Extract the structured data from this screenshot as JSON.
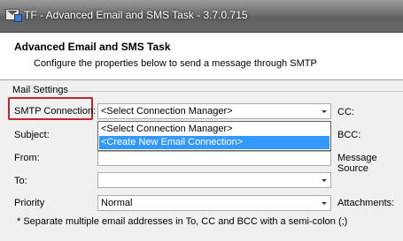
{
  "window": {
    "title": "TF - Advanced Email and SMS Task - 3.7.0.715",
    "icon": "email-task-icon"
  },
  "header": {
    "title": "Advanced Email and SMS Task",
    "subtitle": "Configure the properties below to send a message through SMTP"
  },
  "mail_settings": {
    "group_label": "Mail Settings",
    "smtp_connection": {
      "label": "SMTP Connection:",
      "value": "<Select Connection Manager>",
      "options": [
        "<Select Connection Manager>",
        "<Create New Email Connection>"
      ],
      "highlighted_option": "<Create New Email Connection>"
    },
    "subject_label": "Subject:",
    "from_label": "From:",
    "to_label": "To:",
    "priority": {
      "label": "Priority",
      "value": "Normal"
    },
    "cc_label": "CC:",
    "bcc_label": "BCC:",
    "message_source_label": "Message Source",
    "attachments_label": "Attachments:",
    "note": "* Separate multiple email addresses in To, CC and BCC with a semi-colon (;)"
  },
  "colors": {
    "highlight_box": "#c0262e",
    "selection": "#3399ff"
  }
}
